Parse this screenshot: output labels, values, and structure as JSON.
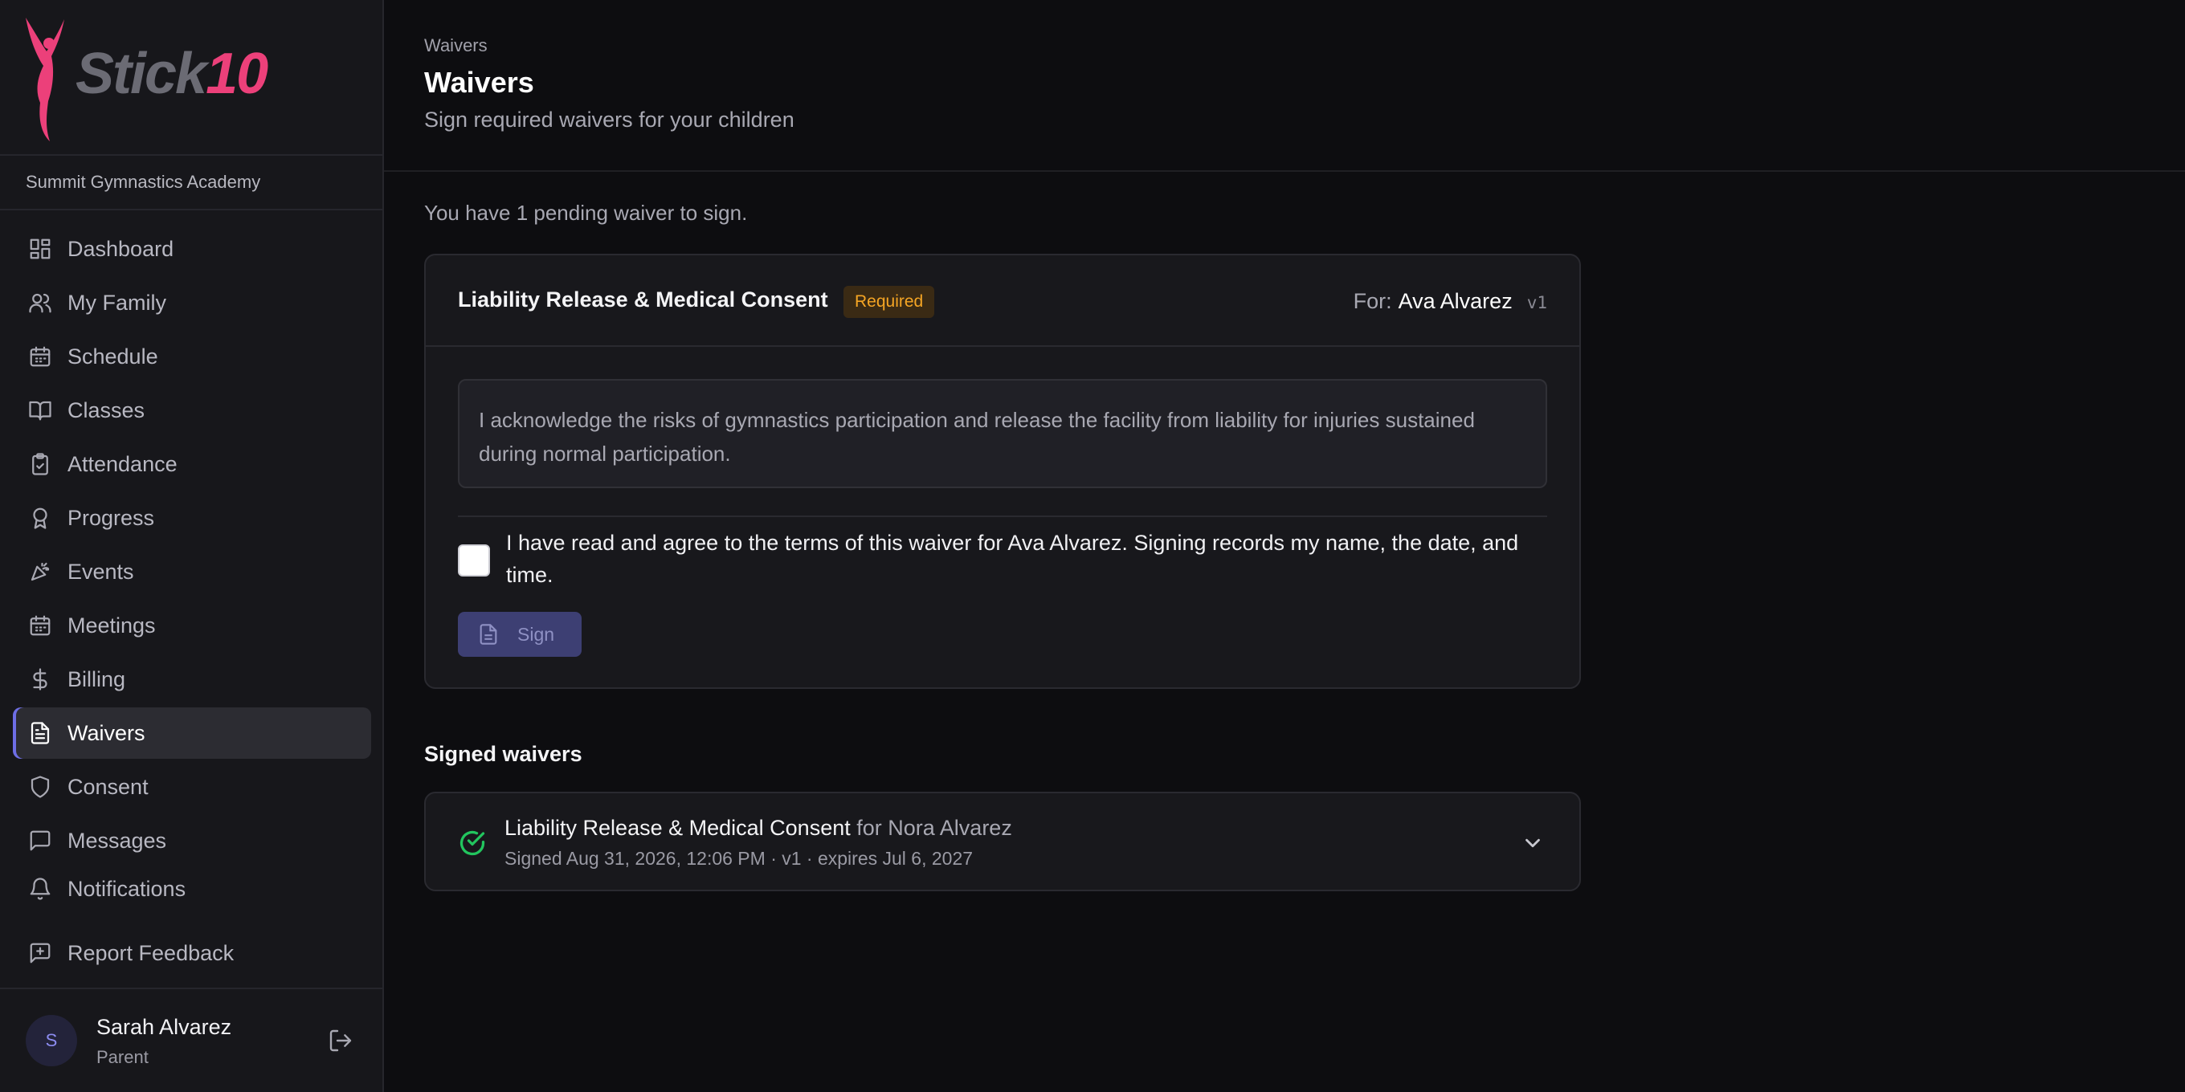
{
  "brand": {
    "logo_word": "Stick",
    "logo_number": "10",
    "accent": "#ec407a"
  },
  "org_name": "Summit Gymnastics Academy",
  "nav": [
    {
      "label": "Dashboard",
      "icon": "dashboard-icon"
    },
    {
      "label": "My Family",
      "icon": "users-icon"
    },
    {
      "label": "Schedule",
      "icon": "calendar-icon"
    },
    {
      "label": "Classes",
      "icon": "book-icon"
    },
    {
      "label": "Attendance",
      "icon": "clipboard-check-icon"
    },
    {
      "label": "Progress",
      "icon": "award-icon"
    },
    {
      "label": "Events",
      "icon": "party-popper-icon"
    },
    {
      "label": "Meetings",
      "icon": "calendar-icon"
    },
    {
      "label": "Billing",
      "icon": "dollar-icon"
    },
    {
      "label": "Waivers",
      "icon": "file-text-icon",
      "active": true
    },
    {
      "label": "Consent",
      "icon": "shield-icon"
    },
    {
      "label": "Messages",
      "icon": "message-square-icon"
    },
    {
      "label": "Notifications",
      "icon": "bell-icon"
    },
    {
      "label": "Report Feedback",
      "icon": "message-plus-icon"
    }
  ],
  "user": {
    "initial": "S",
    "name": "Sarah Alvarez",
    "role": "Parent"
  },
  "header": {
    "breadcrumb": "Waivers",
    "title": "Waivers",
    "subtitle": "Sign required waivers for your children"
  },
  "pending_text": "You have 1 pending waiver to sign.",
  "pending_waiver": {
    "title": "Liability Release & Medical Consent",
    "badge": "Required",
    "for_label": "For:",
    "for_name": "Ava Alvarez",
    "version": "v1",
    "terms": "I acknowledge the risks of gymnastics participation and release the facility from liability for injuries sustained during normal participation.",
    "agree_text": "I have read and agree to the terms of this waiver for Ava Alvarez. Signing records my name, the date, and time.",
    "checked": false,
    "sign_label": "Sign"
  },
  "signed_section": {
    "title": "Signed waivers",
    "items": [
      {
        "title": "Liability Release & Medical Consent",
        "for_text": "for Nora Alvarez",
        "meta": "Signed Aug 31, 2026, 12:06 PM · v1 · expires Jul 6, 2027"
      }
    ]
  },
  "colors": {
    "active_indicator": "#6e6ee6",
    "badge_text": "#f5a524",
    "success": "#22c55e"
  }
}
